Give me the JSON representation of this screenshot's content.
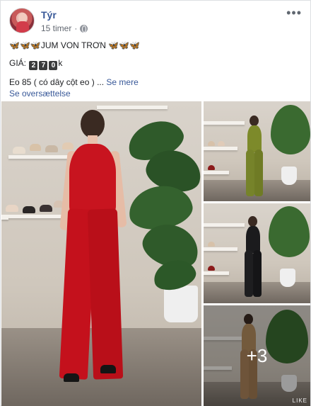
{
  "post": {
    "author": "Týr",
    "time": "15 timer",
    "dot": "·",
    "more_icon": "more-options-icon",
    "line1": "🦋🦋🦋JUM VON TRƠN 🦋🦋🦋",
    "price_label": "GIÁ:",
    "price_digits": [
      "2",
      "7",
      "0"
    ],
    "price_suffix": "k",
    "line3_text": "Eo 85 ( có dây cột eo ) ...",
    "see_more": "Se mere",
    "translate": "Se oversættelse"
  },
  "photos": {
    "more_count": "+3",
    "watermark": "LIKE",
    "colors": {
      "main_outfit": "#c8141f",
      "outfit_green": "#7d8a2a",
      "outfit_black": "#1b1b1d",
      "outfit_tan": "#b18a5c"
    }
  }
}
